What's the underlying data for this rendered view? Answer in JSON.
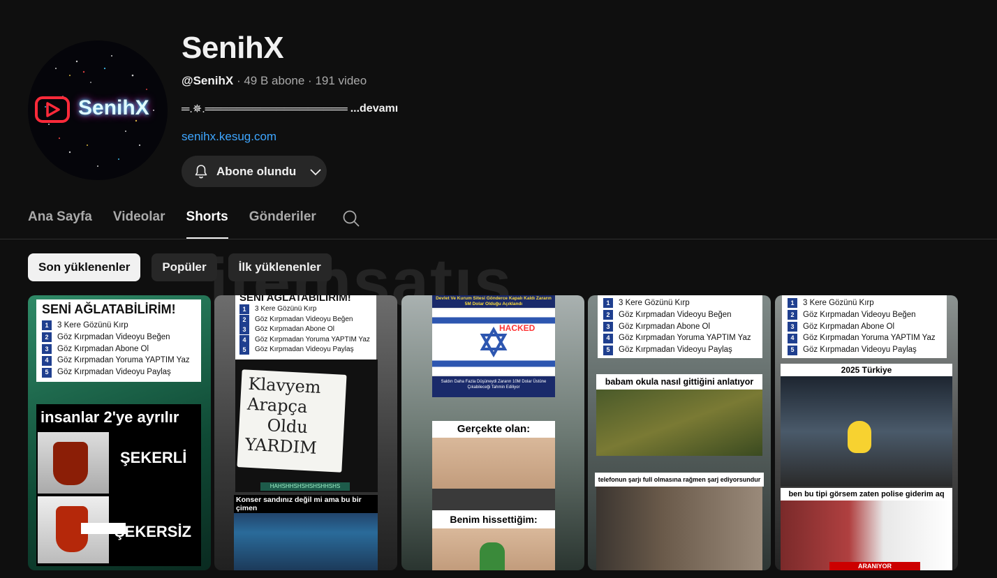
{
  "channel": {
    "name": "SenihX",
    "handle": "@SenihX",
    "subscribers": "49 B abone",
    "videos": "191 video",
    "separator": "·",
    "description": "═.✵.══════════════════",
    "more_label": "...devamı",
    "link": "senihx.kesug.com",
    "avatar_text": "SenihX",
    "subscribe_label": "Abone olundu"
  },
  "tabs": [
    {
      "label": "Ana Sayfa"
    },
    {
      "label": "Videolar"
    },
    {
      "label": "Shorts"
    },
    {
      "label": "Gönderiler"
    }
  ],
  "chips": [
    {
      "label": "Son yüklenenler"
    },
    {
      "label": "Popüler"
    },
    {
      "label": "İlk yüklenenler"
    }
  ],
  "watermark": "itemsatış",
  "shorts": [
    {
      "title": "SENİ AĞLATABİLİRİM!",
      "steps": [
        "3 Kere Gözünü Kırp",
        "Göz Kırpmadan Videoyu Beğen",
        "Göz Kırpmadan Abone Ol",
        "Göz Kırpmadan Yoruma YAPTIM Yaz",
        "Göz Kırpmadan Videoyu Paylaş"
      ],
      "headline": "insanlar 2'ye ayrılır",
      "label_a": "ŞEKERLİ",
      "label_b": "ŞEKERSİZ"
    },
    {
      "title": "SENİ AĞLATABİLİRİM!",
      "steps": [
        "3 Kere Gözünü Kırp",
        "Göz Kırpmadan Videoyu Beğen",
        "Göz Kırpmadan Abone Ol",
        "Göz Kırpmadan Yoruma YAPTIM Yaz",
        "Göz Kırpmadan Videoyu Paylaş"
      ],
      "note_lines": [
        "Klavyem",
        "Arapça",
        "Oldu",
        "YARDIM"
      ],
      "chat_msg": "HAHSHHSHSHSHSHHSHS",
      "caption": "Konser sandınız değil mi ama bu bir çimen"
    },
    {
      "news_title": "Devlet Ve Kurum Sitesi Gönderce Kapalı Kaldı Zararın 5M Dolar Olduğu Açıklandı",
      "hacked": "HACKED",
      "news_sub": "Saldırı Daha Fazla Düşüneydi Zararın 10M Dolar Üstüne Çıkabileceği Tahmin Ediliyor",
      "caption_a": "Gerçekte olan:",
      "caption_b": "Benim hissettiğim:"
    },
    {
      "steps": [
        "3 Kere Gözünü Kırp",
        "Göz Kırpmadan Videoyu Beğen",
        "Göz Kırpmadan Abone Ol",
        "Göz Kırpmadan Yoruma YAPTIM Yaz",
        "Göz Kırpmadan Videoyu Paylaş"
      ],
      "caption_a": "babam okula nasıl gittiğini anlatıyor",
      "caption_b": "telefonun şarjı full olmasına rağmen şarj ediyorsundur"
    },
    {
      "steps": [
        "3 Kere Gözünü Kırp",
        "Göz Kırpmadan Videoyu Beğen",
        "Göz Kırpmadan Abone Ol",
        "Göz Kırpmadan Yoruma YAPTIM Yaz",
        "Göz Kırpmadan Videoyu Paylaş"
      ],
      "caption_a": "2025 Türkiye",
      "caption_b": "ben bu tipi görsem zaten polise giderim aq",
      "banner": "ARANIYOR"
    }
  ]
}
